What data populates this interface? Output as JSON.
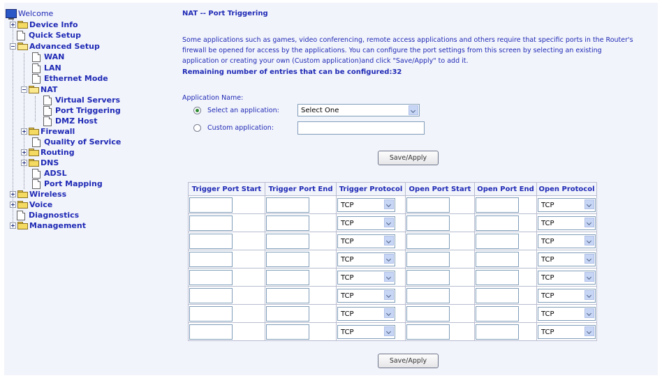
{
  "nav": {
    "welcome": "Welcome",
    "device_info": "Device Info",
    "quick_setup": "Quick Setup",
    "advanced_setup": "Advanced Setup",
    "wan": "WAN",
    "lan": "LAN",
    "ethernet_mode": "Ethernet Mode",
    "nat": "NAT",
    "virtual_servers": "Virtual Servers",
    "port_triggering": "Port Triggering",
    "dmz_host": "DMZ Host",
    "firewall": "Firewall",
    "qos": "Quality of Service",
    "routing": "Routing",
    "dns": "DNS",
    "adsl": "ADSL",
    "port_mapping": "Port Mapping",
    "wireless": "Wireless",
    "voice": "Voice",
    "diagnostics": "Diagnostics",
    "management": "Management"
  },
  "page": {
    "title": "NAT -- Port Triggering",
    "description": "Some applications such as games, video conferencing, remote access applications and others require that specific ports in the Router's firewall be opened for access by the applications. You can configure the port settings from this screen by selecting an existing application or creating your own (Custom application)and click \"Save/Apply\" to add it.",
    "remaining": "Remaining number of entries that can be configured:32",
    "app_name_label": "Application Name:",
    "select_app_label": "Select an application:",
    "select_app_value": "Select One",
    "custom_app_label": "Custom application:",
    "custom_app_value": "",
    "save_apply": "Save/Apply"
  },
  "table": {
    "headers": [
      "Trigger Port Start",
      "Trigger Port End",
      "Trigger Protocol",
      "Open Port Start",
      "Open Port End",
      "Open Protocol"
    ],
    "rows": [
      {
        "trigger_start": "",
        "trigger_end": "",
        "trigger_protocol": "TCP",
        "open_start": "",
        "open_end": "",
        "open_protocol": "TCP"
      },
      {
        "trigger_start": "",
        "trigger_end": "",
        "trigger_protocol": "TCP",
        "open_start": "",
        "open_end": "",
        "open_protocol": "TCP"
      },
      {
        "trigger_start": "",
        "trigger_end": "",
        "trigger_protocol": "TCP",
        "open_start": "",
        "open_end": "",
        "open_protocol": "TCP"
      },
      {
        "trigger_start": "",
        "trigger_end": "",
        "trigger_protocol": "TCP",
        "open_start": "",
        "open_end": "",
        "open_protocol": "TCP"
      },
      {
        "trigger_start": "",
        "trigger_end": "",
        "trigger_protocol": "TCP",
        "open_start": "",
        "open_end": "",
        "open_protocol": "TCP"
      },
      {
        "trigger_start": "",
        "trigger_end": "",
        "trigger_protocol": "TCP",
        "open_start": "",
        "open_end": "",
        "open_protocol": "TCP"
      },
      {
        "trigger_start": "",
        "trigger_end": "",
        "trigger_protocol": "TCP",
        "open_start": "",
        "open_end": "",
        "open_protocol": "TCP"
      },
      {
        "trigger_start": "",
        "trigger_end": "",
        "trigger_protocol": "TCP",
        "open_start": "",
        "open_end": "",
        "open_protocol": "TCP"
      }
    ]
  },
  "colors": {
    "link": "#1f2ab5",
    "background": "#f2f4fb",
    "radio_selected": "#2f8a32"
  }
}
